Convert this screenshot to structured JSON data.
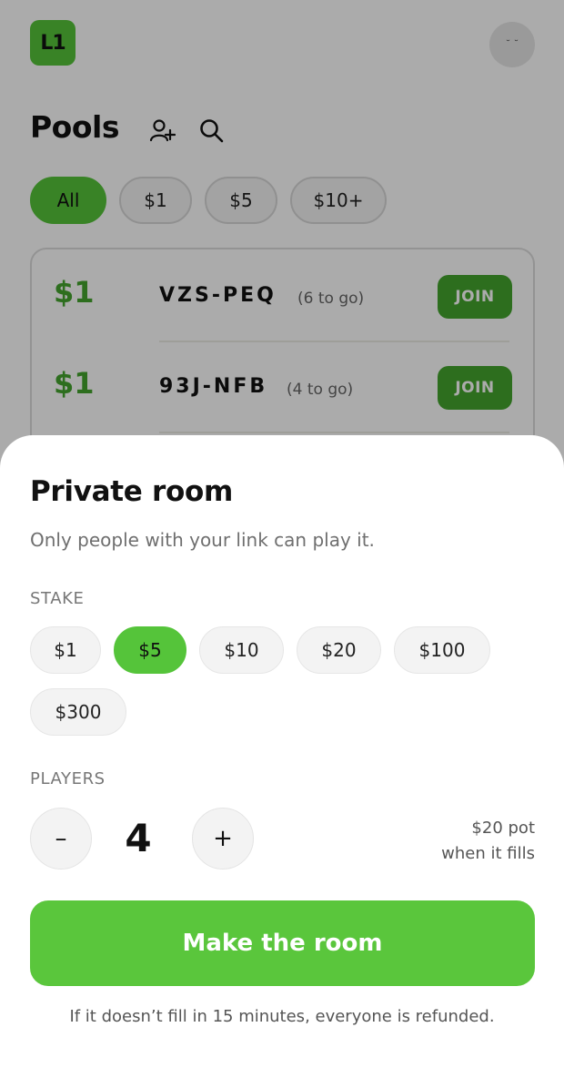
{
  "header": {
    "logo_text": "L1",
    "avatar_glyph": "˘ ˘\nʼ"
  },
  "pools": {
    "title": "Pools",
    "filters": [
      {
        "label": "All",
        "active": true
      },
      {
        "label": "$1",
        "active": false
      },
      {
        "label": "$5",
        "active": false
      },
      {
        "label": "$10+",
        "active": false
      }
    ],
    "list": [
      {
        "amount": "$1",
        "code": "VZS-PEQ",
        "remaining": "(6 to go)",
        "action": "JOIN"
      },
      {
        "amount": "$1",
        "code": "93J-NFB",
        "remaining": "(4 to go)",
        "action": "JOIN"
      }
    ]
  },
  "sheet": {
    "title": "Private room",
    "subtitle": "Only people with your link can play it.",
    "stake_label": "STAKE",
    "stakes": [
      {
        "label": "$1",
        "active": false
      },
      {
        "label": "$5",
        "active": true
      },
      {
        "label": "$10",
        "active": false
      },
      {
        "label": "$20",
        "active": false
      },
      {
        "label": "$100",
        "active": false
      },
      {
        "label": "$300",
        "active": false
      }
    ],
    "players_label": "PLAYERS",
    "minus": "–",
    "plus": "+",
    "player_count": "4",
    "pot_line1": "$20 pot",
    "pot_line2": "when it fills",
    "make_button": "Make the room",
    "refund_note": "If it doesn’t fill in 15 minutes, everyone is refunded."
  },
  "colors": {
    "accent": "#55c43a",
    "accent_dark": "#43a52e",
    "primary_button": "#5ac63c",
    "overlay": "rgba(0,0,0,0.33)"
  }
}
